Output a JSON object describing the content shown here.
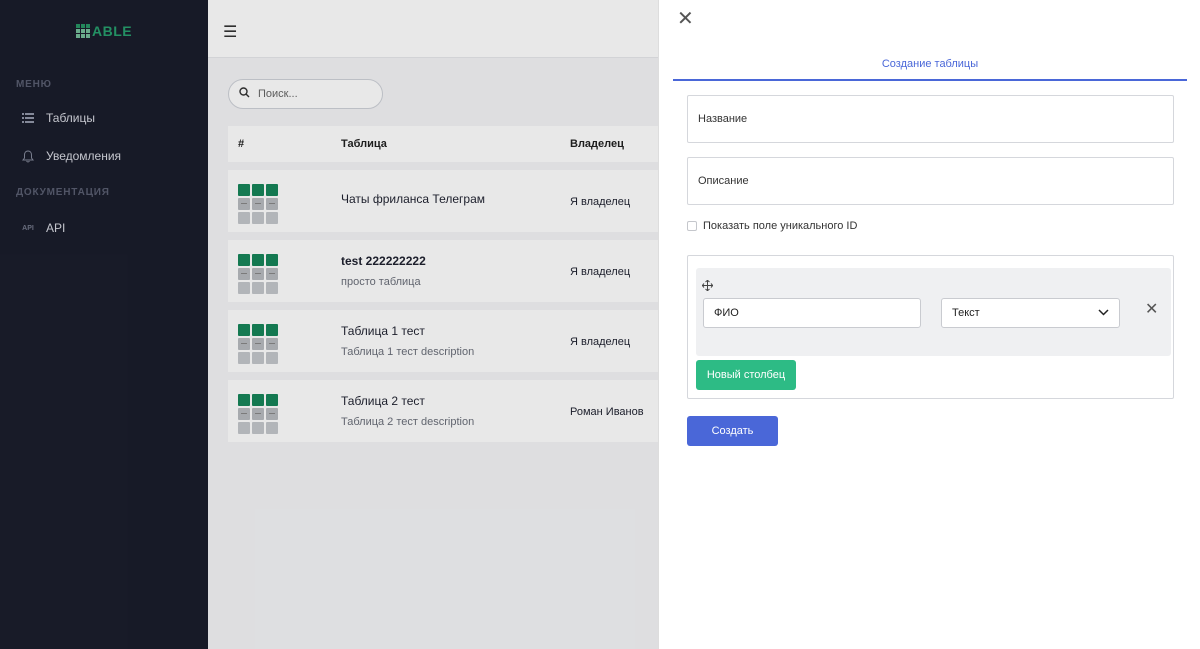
{
  "sidebar": {
    "logo_text": "ABLE",
    "menu_section": "МЕНЮ",
    "docs_section": "ДОКУМЕНТАЦИЯ",
    "items": [
      {
        "label": "Таблицы",
        "icon": "list-icon"
      },
      {
        "label": "Уведомления",
        "icon": "bell-icon"
      },
      {
        "label": "API",
        "icon": "api-icon"
      }
    ]
  },
  "main": {
    "search_placeholder": "Поиск...",
    "table": {
      "columns": [
        "#",
        "Таблица",
        "Владелец"
      ],
      "rows": [
        {
          "name": "Чаты фриланса Телеграм",
          "description": "",
          "owner": "Я владелец"
        },
        {
          "name": "test 222222222",
          "description": "просто таблица",
          "owner": "Я владелец"
        },
        {
          "name": "Таблица 1 тест",
          "description": "Таблица 1 тест description",
          "owner": "Я владелец"
        },
        {
          "name": "Таблица 2 тест",
          "description": "Таблица 2 тест description",
          "owner": "Роман Иванов"
        }
      ]
    }
  },
  "drawer": {
    "tab_title": "Создание таблицы",
    "name_placeholder": "Название",
    "description_placeholder": "Описание",
    "unique_id_label": "Показать поле уникального ID",
    "column": {
      "name_value": "ФИО",
      "type_value": "Текст"
    },
    "new_column_button": "Новый столбец",
    "create_button": "Создать"
  },
  "colors": {
    "sidebar_bg": "#1c1f2e",
    "accent_blue": "#4a67d8",
    "accent_green": "#2dbb85",
    "logo_green": "#16855a"
  }
}
